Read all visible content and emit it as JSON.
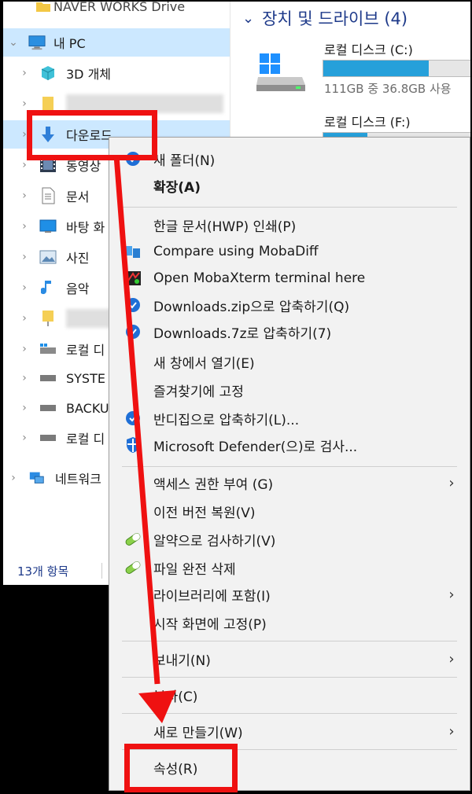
{
  "nav": {
    "top_partial": "NAVER WORKS Drive",
    "items": [
      {
        "label": "내 PC",
        "icon": "computer-icon"
      },
      {
        "label": "3D 개체",
        "icon": "cube-3d-icon"
      },
      {
        "label": "",
        "icon": "folder-icon"
      },
      {
        "label": "다운로드",
        "icon": "download-arrow-icon"
      },
      {
        "label": "동영상",
        "icon": "film-icon"
      },
      {
        "label": "문서",
        "icon": "document-icon"
      },
      {
        "label": "바탕 화",
        "icon": "desktop-icon"
      },
      {
        "label": "사진",
        "icon": "picture-icon"
      },
      {
        "label": "음악",
        "icon": "music-note-icon"
      },
      {
        "label": "",
        "icon": "folder-icon"
      },
      {
        "label": "로컬 디",
        "icon": "drive-icon"
      },
      {
        "label": "SYSTE",
        "icon": "drive-icon"
      },
      {
        "label": "BACKU",
        "icon": "drive-icon"
      },
      {
        "label": "로컬 디",
        "icon": "drive-icon"
      },
      {
        "label": "네트워크",
        "icon": "network-icon"
      }
    ],
    "status": "13개 항목"
  },
  "content": {
    "section_title": "장치 및 드라이브 (4)",
    "drives": [
      {
        "name": "로컬 디스크 (C:)",
        "info": "111GB 중 36.8GB 사용",
        "used_fraction": 0.67
      },
      {
        "name": "로컬 디스크 (F:)",
        "info": "",
        "used_fraction": 0.28
      }
    ]
  },
  "menu": {
    "items": [
      {
        "label": "새 폴더(N)",
        "icon": "blue-circle-icon"
      },
      {
        "label": "확장(A)",
        "bold": true
      },
      {
        "label": "한글 문서(HWP) 인쇄(P)"
      },
      {
        "label": "Compare using MobaDiff",
        "icon": "mobadiff-icon"
      },
      {
        "label": "Open MobaXterm terminal here",
        "icon": "mobaxterm-icon"
      },
      {
        "label": "Downloads.zip으로 압축하기(Q)",
        "icon": "blue-circle-icon"
      },
      {
        "label": "Downloads.7z로 압축하기(7)",
        "icon": "blue-circle-icon"
      },
      {
        "label": "새 창에서 열기(E)"
      },
      {
        "label": "즐겨찾기에 고정"
      },
      {
        "label": "반디집으로 압축하기(L)...",
        "icon": "blue-circle-icon"
      },
      {
        "label": "Microsoft Defender(으)로 검사...",
        "icon": "defender-shield-icon"
      },
      {
        "label": "액세스 권한 부여 (G)",
        "submenu": true
      },
      {
        "label": "이전 버전 복원(V)"
      },
      {
        "label": "알약으로 검사하기(V)",
        "icon": "pill-icon"
      },
      {
        "label": "파일 완전 삭제",
        "icon": "pill-icon"
      },
      {
        "label": "라이브러리에 포함(I)",
        "submenu": true
      },
      {
        "label": "시작 화면에 고정(P)"
      },
      {
        "label": "보내기(N)",
        "submenu": true
      },
      {
        "label": "복사(C)"
      },
      {
        "label": "새로 만들기(W)",
        "submenu": true
      },
      {
        "label": "속성(R)"
      }
    ]
  },
  "annotation": {
    "color": "#ef1111"
  }
}
